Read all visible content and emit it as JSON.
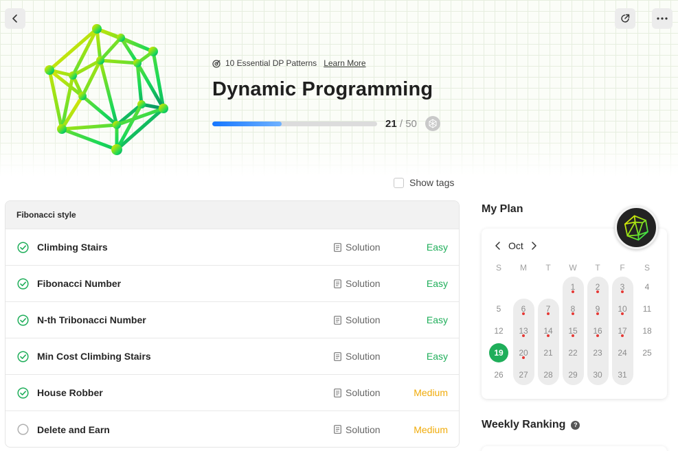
{
  "header": {
    "patterns_label": "10 Essential DP Patterns",
    "learn_more": "Learn More",
    "title": "Dynamic Programming",
    "progress": {
      "solved": "21",
      "separator": " / ",
      "total": "50",
      "fraction": 0.42
    }
  },
  "toolbar": {
    "back_icon": "chevron-left-icon",
    "share_icon": "external-link-icon",
    "more_icon": "ellipsis-icon"
  },
  "filters": {
    "show_tags_label": "Show tags",
    "show_tags_checked": false
  },
  "problem_group": {
    "name": "Fibonacci style",
    "problems": [
      {
        "name": "Climbing Stairs",
        "solution_label": "Solution",
        "difficulty": "Easy",
        "solved": true
      },
      {
        "name": "Fibonacci Number",
        "solution_label": "Solution",
        "difficulty": "Easy",
        "solved": true
      },
      {
        "name": "N-th Tribonacci Number",
        "solution_label": "Solution",
        "difficulty": "Easy",
        "solved": true
      },
      {
        "name": "Min Cost Climbing Stairs",
        "solution_label": "Solution",
        "difficulty": "Easy",
        "solved": true
      },
      {
        "name": "House Robber",
        "solution_label": "Solution",
        "difficulty": "Medium",
        "solved": true
      },
      {
        "name": "Delete and Earn",
        "solution_label": "Solution",
        "difficulty": "Medium",
        "solved": false
      }
    ]
  },
  "plan": {
    "title": "My Plan",
    "month": "Oct",
    "weekdays": [
      "S",
      "M",
      "T",
      "W",
      "T",
      "F",
      "S"
    ],
    "today": "19",
    "weeks": [
      [
        "",
        "",
        "",
        "1",
        "2",
        "3",
        "4"
      ],
      [
        "5",
        "6",
        "7",
        "8",
        "9",
        "10",
        "11"
      ],
      [
        "12",
        "13",
        "14",
        "15",
        "16",
        "17",
        "18"
      ],
      [
        "19",
        "20",
        "21",
        "22",
        "23",
        "24",
        "25"
      ],
      [
        "26",
        "27",
        "28",
        "29",
        "30",
        "31",
        ""
      ]
    ],
    "marked_days": [
      "1",
      "2",
      "3",
      "6",
      "7",
      "8",
      "9",
      "10",
      "13",
      "14",
      "15",
      "16",
      "17",
      "20"
    ]
  },
  "ranking": {
    "title": "Weekly Ranking",
    "help_icon": "?"
  },
  "colors": {
    "easy": "#1fae5a",
    "medium": "#f0ab0a",
    "progress": "#1677ff",
    "today": "#1fae5a",
    "marker": "#e53935"
  }
}
